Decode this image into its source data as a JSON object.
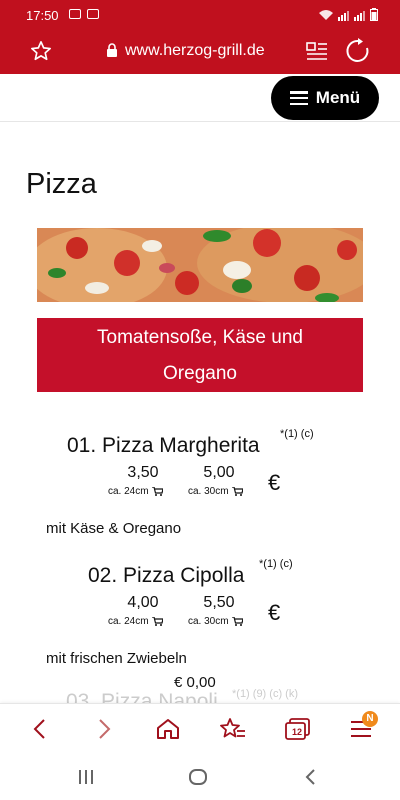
{
  "status": {
    "time": "17:50",
    "battery_icon": "battery-icon",
    "wifi_icon": "wifi-icon",
    "signal_icon": "signal-icon"
  },
  "browser": {
    "url": "www.herzog-grill.de",
    "star_icon": "star-icon",
    "lock_icon": "lock-icon",
    "reader_icon": "reader-mode-icon",
    "reload_icon": "reload-icon"
  },
  "header": {
    "menu_label": "Menü"
  },
  "page": {
    "section_title": "Pizza",
    "category_banner_line1": "Tomatensoße, Käse und",
    "category_banner_line2": "Oregano"
  },
  "items": [
    {
      "name": "01. Pizza Margherita",
      "marks": "*(1) (c)",
      "price_small": "3,50",
      "price_large": "5,00",
      "size_small": "ca. 24cm",
      "size_large": "ca. 30cm",
      "currency": "€",
      "description": "mit Käse & Oregano"
    },
    {
      "name": "02. Pizza Cipolla",
      "marks": "*(1) (c)",
      "price_small": "4,00",
      "price_large": "5,50",
      "size_small": "ca. 24cm",
      "size_large": "ca. 30cm",
      "currency": "€",
      "description": "mit frischen Zwiebeln"
    }
  ],
  "cart": {
    "total": "€ 0,00"
  },
  "next_item_partial": {
    "name": "03. Pizza Napoli",
    "marks": "*(1) (9) (c) (k)"
  },
  "bottom_nav": {
    "tabs_count": "12",
    "badge": "N"
  },
  "colors": {
    "brand_red": "#c0101e",
    "banner_red": "#c4102a",
    "badge_orange": "#f08a1c"
  }
}
